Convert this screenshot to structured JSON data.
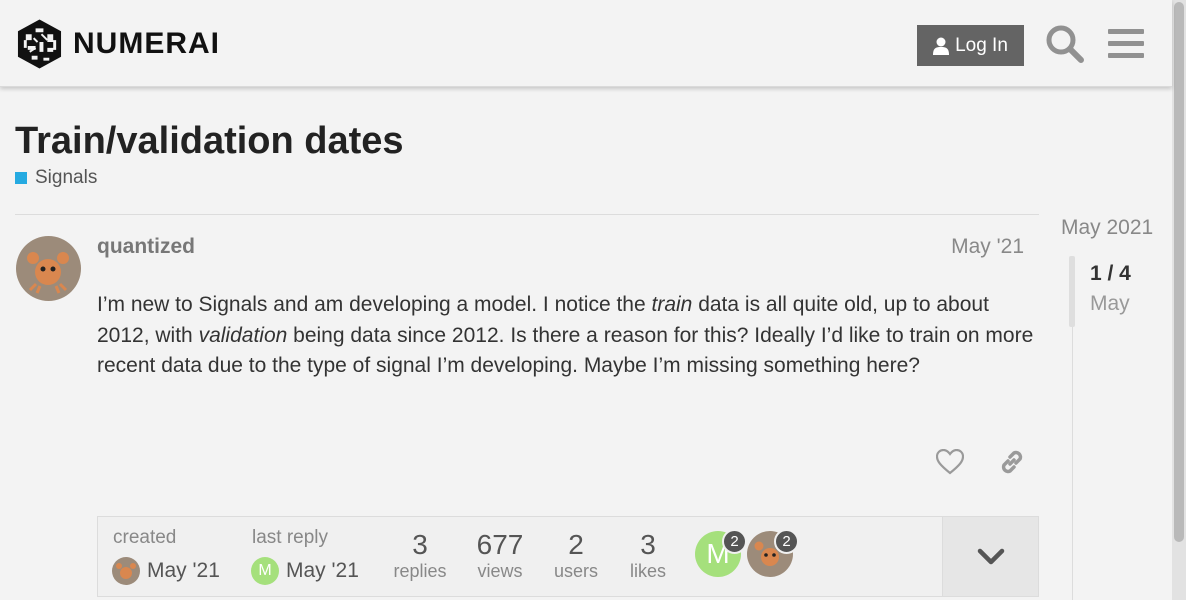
{
  "header": {
    "logo_text": "NUMERAI",
    "login_label": "Log In"
  },
  "topic": {
    "title": "Train/validation dates",
    "category": "Signals",
    "category_color": "#25aae1"
  },
  "post": {
    "username": "quantized",
    "date": "May '21",
    "body_parts": {
      "p1": "I’m new to Signals and am developing a model. I notice the ",
      "em1": "train",
      "p2": " data is all quite old, up to about 2012, with ",
      "em2": "validation",
      "p3": " being data since 2012. Is there a reason for this? Ideally I’d like to train on more recent data due to the type of signal I’m developing. Maybe I’m missing something here?"
    }
  },
  "topic_map": {
    "created_label": "created",
    "created_date": "May '21",
    "last_reply_label": "last reply",
    "last_reply_date": "May '21",
    "last_reply_avatar_letter": "M",
    "stats": [
      {
        "value": "3",
        "label": "replies"
      },
      {
        "value": "677",
        "label": "views"
      },
      {
        "value": "2",
        "label": "users"
      },
      {
        "value": "3",
        "label": "likes"
      }
    ],
    "participants": [
      {
        "letter": "M",
        "count": "2",
        "color": "#a5e07c"
      },
      {
        "letter": "",
        "count": "2",
        "color": "#c8876a"
      }
    ]
  },
  "timeline": {
    "top_date": "May 2021",
    "position": "1 / 4",
    "current_date": "May"
  }
}
